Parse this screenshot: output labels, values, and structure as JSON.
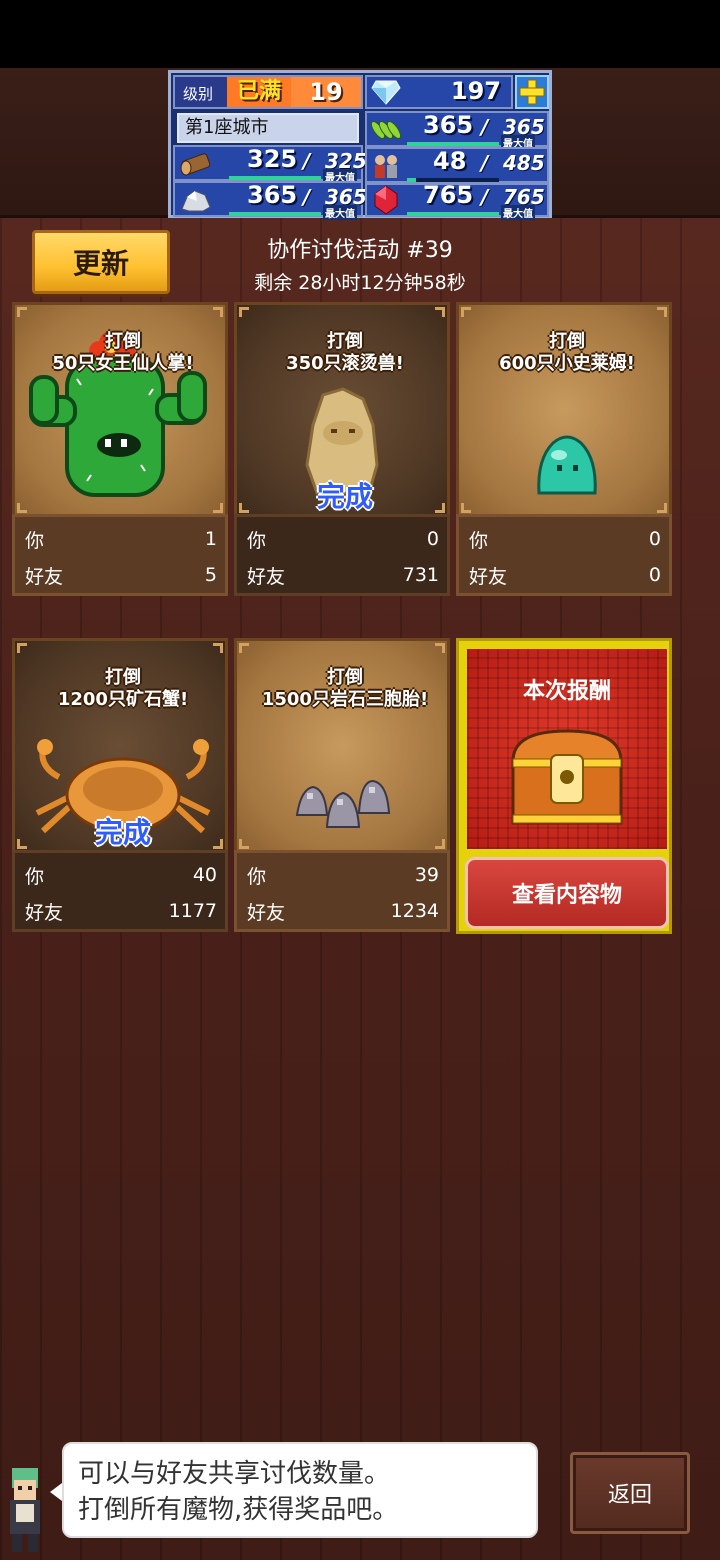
{
  "hud": {
    "level_label": "级别",
    "level_badge": "已满",
    "level_value": "19",
    "gems": "197",
    "city": "第1座城市",
    "food": "365",
    "food_max": "365",
    "food_fill": 1.0,
    "wood": "325",
    "wood_max": "325",
    "wood_fill": 1.0,
    "population": "48",
    "population_max": "485",
    "population_fill": 0.1,
    "ore": "365",
    "ore_max": "365",
    "ore_fill": 1.0,
    "ruby": "765",
    "ruby_max": "765",
    "ruby_fill": 1.0,
    "max_tag": "最大值",
    "slash": "/"
  },
  "header": {
    "refresh_label": "更新",
    "event_title": "协作讨伐活动 #39",
    "event_timer": "剩余 28小时12分钟58秒"
  },
  "labels": {
    "you": "你",
    "friends": "好友",
    "done": "完成"
  },
  "cards": [
    {
      "title": "打倒\n50只女王仙人掌!",
      "you": "1",
      "friends": "5",
      "done": false
    },
    {
      "title": "打倒\n350只滚烫兽!",
      "you": "0",
      "friends": "731",
      "done": true
    },
    {
      "title": "打倒\n600只小史莱姆!",
      "you": "0",
      "friends": "0",
      "done": false
    },
    {
      "title": "打倒\n1200只矿石蟹!",
      "you": "40",
      "friends": "1177",
      "done": true
    },
    {
      "title": "打倒\n1500只岩石三胞胎!",
      "you": "39",
      "friends": "1234",
      "done": false
    }
  ],
  "reward": {
    "title": "本次报酬",
    "button": "查看内容物"
  },
  "dialog": {
    "line1": "可以与好友共享讨伐数量。",
    "line2": "打倒所有魔物,获得奖品吧。"
  },
  "back_label": "返回",
  "colors": {
    "accent_done": "#2f5bff",
    "hud_bar": "#2fd39a",
    "refresh_btn": "#ffc030"
  }
}
